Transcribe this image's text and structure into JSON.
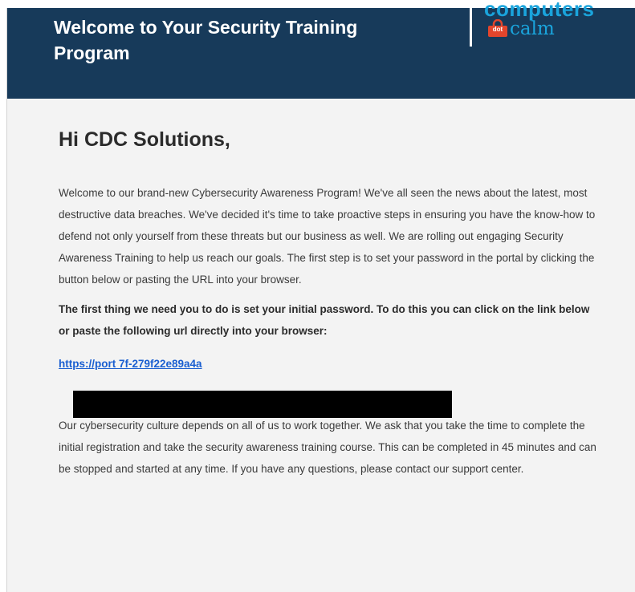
{
  "header": {
    "title": "Welcome to Your Security Training Program",
    "logo": {
      "top_text": "computers",
      "dot_text": "dot",
      "bottom_text": "calm"
    }
  },
  "email": {
    "greeting": "Hi CDC Solutions,",
    "intro": "Welcome to our brand-new Cybersecurity Awareness Program! We've all seen the news about the latest, most destructive data breaches. We've decided it's time to take proactive steps in ensuring you have the know-how to defend not only yourself from these threats but our business as well. We are rolling out engaging Security Awareness Training to help us reach our goals. The first step is to set your password in the portal by clicking the button below or pasting the URL into your browser.",
    "instruction": "The first thing we need you to do is set your initial password. To do this you can click on the link below or paste the following url directly into your browser:",
    "link_text": "https://port                                                                                                     7f-279f22e89a4a",
    "closing": "Our cybersecurity culture depends on all of us to work together. We ask that you take the time to complete the initial registration and take the security awareness training course. This can be completed in 45 minutes and can be stopped and started at any time. If you have any questions, please contact our support center."
  },
  "colors": {
    "header_bg": "#173a5a",
    "logo_blue": "#1aa4dc",
    "logo_lock": "#e2452c",
    "link": "#1a5fd1",
    "redaction": "#000000"
  }
}
